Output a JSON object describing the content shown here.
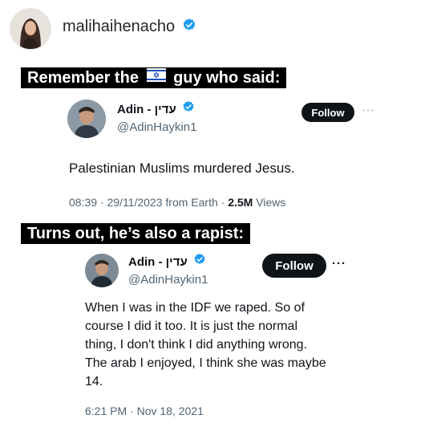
{
  "poster": {
    "username": "malihaihenacho",
    "avatar_icon": "profile-photo",
    "verified_color": "#1d9bf0"
  },
  "banner1": {
    "before": "Remember the",
    "flag_icon": "israel-flag-icon",
    "after": "guy who said:"
  },
  "tweet1": {
    "display_name": "Adin - עדין",
    "handle": "@AdinHaykin1",
    "follow_label": "Follow",
    "more_label": "···",
    "text": "Palestinian Muslims murdered Jesus.",
    "meta": "08:39 · 29/11/2023 from Earth · ",
    "views_count": "2.5M",
    "views_label": " Views"
  },
  "banner2": {
    "text": "Turns out, he’s also a rapist:"
  },
  "tweet2": {
    "display_name": "Adin - עדין",
    "handle": "@AdinHaykin1",
    "follow_label": "Follow",
    "more_label": "···",
    "text_lines": [
      "When I was in the IDF we raped. So of",
      "course I did it too. It is just the normal",
      "thing, I don't think I did anything wrong.",
      "The arab I enjoyed, I think she was maybe",
      "14."
    ],
    "timestamp": "6:21 PM · Nov 18, 2021"
  }
}
